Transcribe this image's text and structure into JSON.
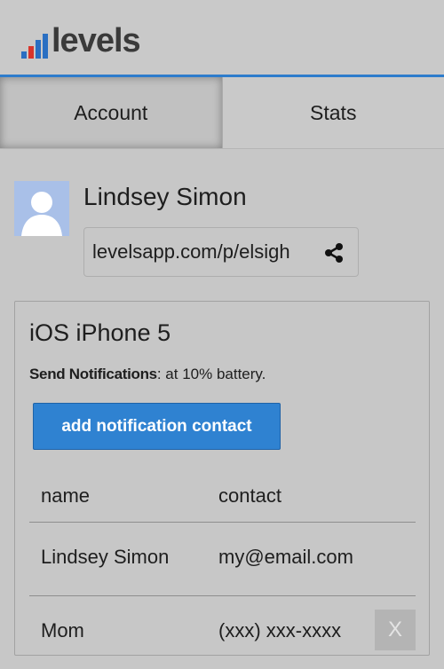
{
  "app": {
    "logo_text": "levels",
    "logo_colors": [
      "#2a6fc2",
      "#d9352b",
      "#2a6fc2",
      "#2a6fc2"
    ]
  },
  "tabs": [
    {
      "label": "Account",
      "active": true
    },
    {
      "label": "Stats",
      "active": false
    }
  ],
  "profile": {
    "name": "Lindsey Simon",
    "link": "levelsapp.com/p/elsigh"
  },
  "device": {
    "name": "iOS iPhone 5",
    "notify_label": "Send Notifications",
    "notify_text": ": at 10% battery.",
    "add_button_label": "add notification contact",
    "table": {
      "headers": [
        "name",
        "contact"
      ],
      "rows": [
        {
          "name": "Lindsey Simon",
          "contact": "my@email.com"
        },
        {
          "name": "Mom",
          "contact": "(xxx) xxx-xxxx",
          "delete_label": "X"
        }
      ]
    }
  },
  "colors": {
    "accent": "#2d7ccc",
    "button": "#2f82d1"
  }
}
